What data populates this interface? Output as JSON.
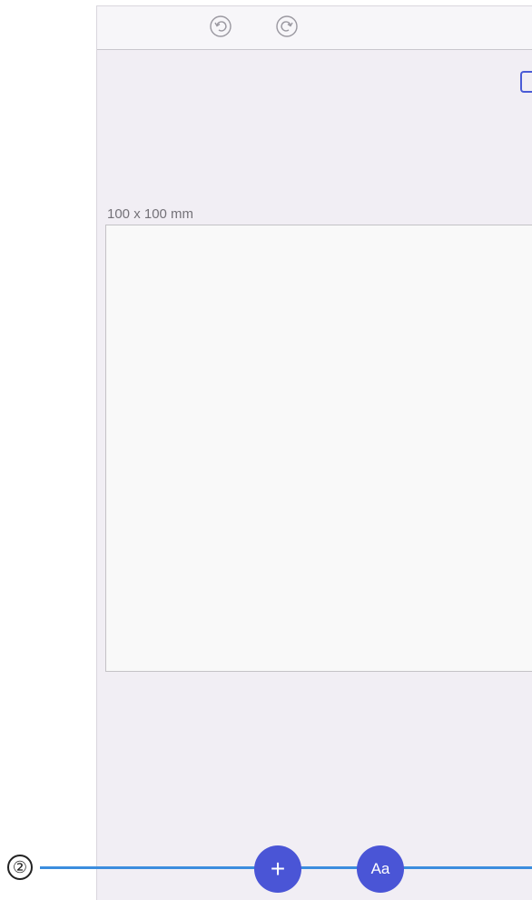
{
  "toolbar": {
    "undo_icon": "undo-icon",
    "redo_icon": "redo-icon"
  },
  "canvas": {
    "size_label": "100 x 100 mm"
  },
  "bottom_actions": {
    "add_label": "+",
    "text_label": "Aa"
  },
  "callout": {
    "number": "②"
  },
  "colors": {
    "screen_background": "#f1eef4",
    "accent": "#4a55d6",
    "callout_line": "#3c8dde"
  }
}
